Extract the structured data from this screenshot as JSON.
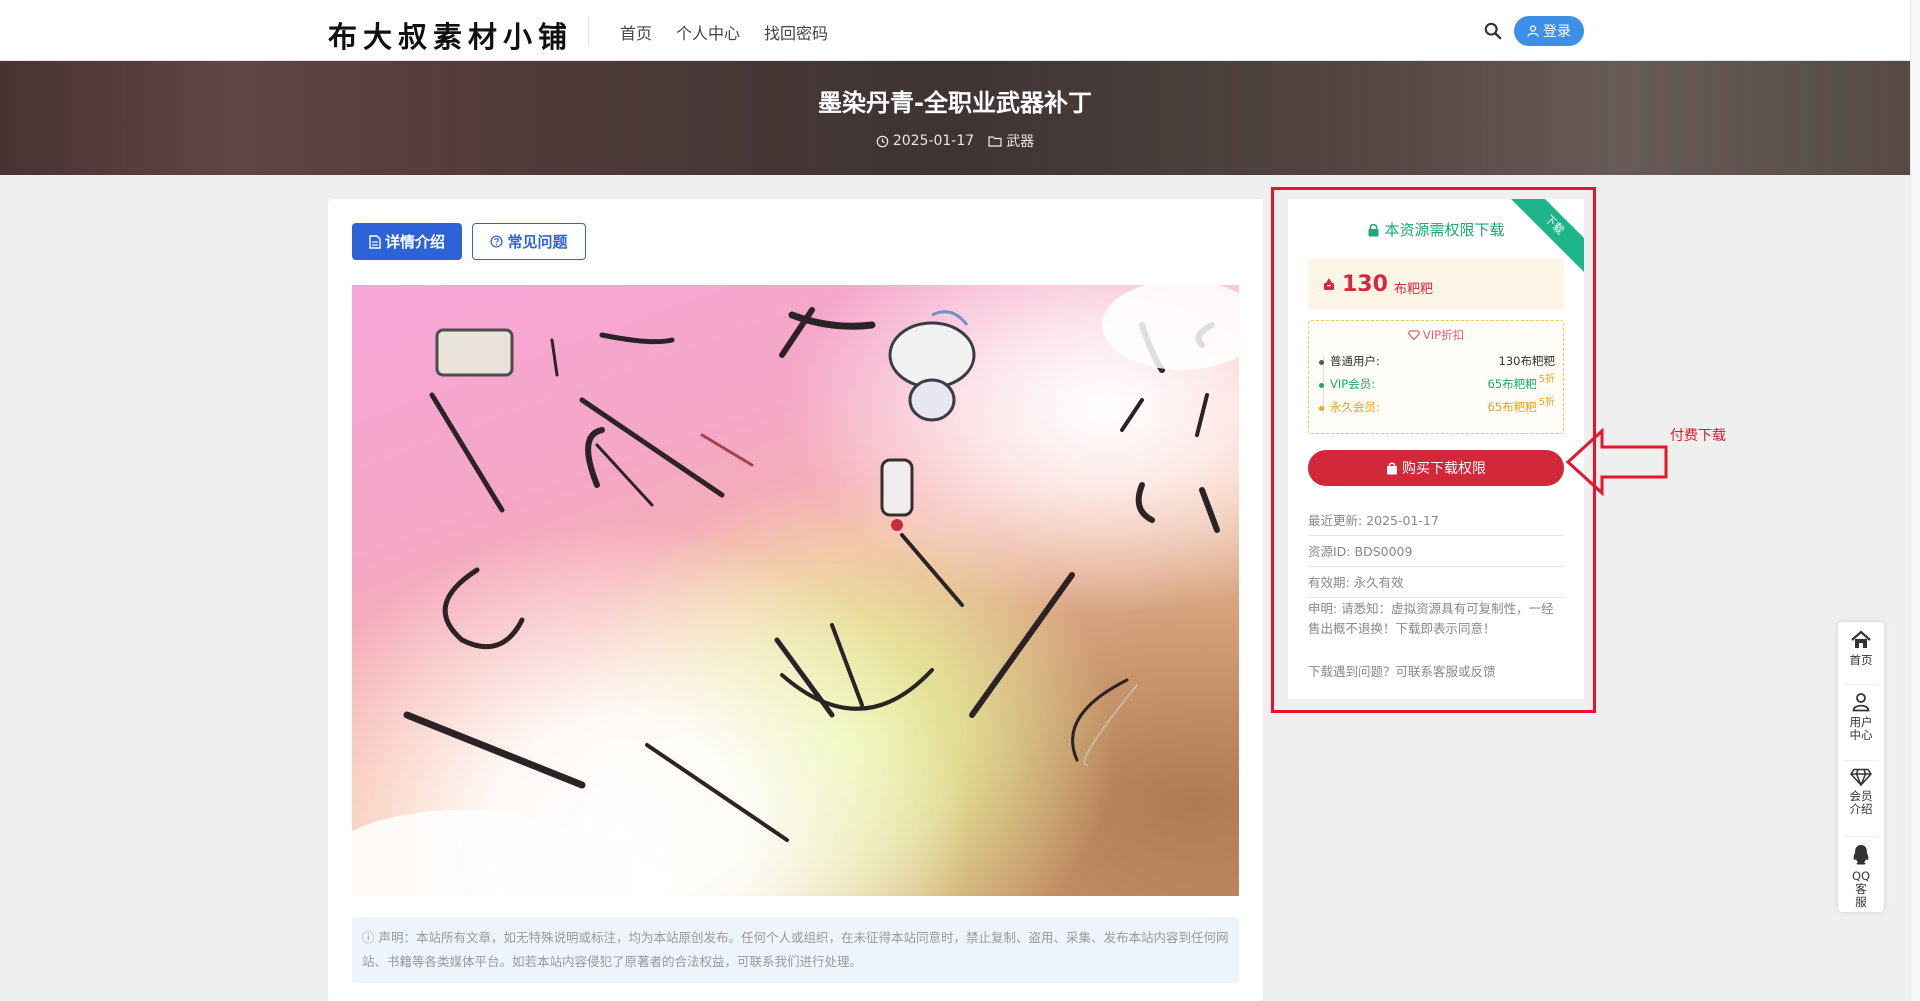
{
  "header": {
    "logo": "布大叔素材小铺",
    "nav": [
      "首页",
      "个人中心",
      "找回密码"
    ],
    "login_label": "登录"
  },
  "hero": {
    "title": "墨染丹青-全职业武器补丁",
    "date": "2025-01-17",
    "category": "武器"
  },
  "article": {
    "tabs": [
      "详情介绍",
      "常见问题"
    ],
    "notice": "声明：本站所有文章，如无特殊说明或标注，均为本站原创发布。任何个人或组织，在未征得本站同意时，禁止复制、盗用、采集、发布本站内容到任何网站、书籍等各类媒体平台。如若本站内容侵犯了原著者的合法权益，可联系我们进行处理。"
  },
  "widget": {
    "ribbon": "下载",
    "heading": "本资源需权限下载",
    "price_amount": "130",
    "price_unit": "布粑粑",
    "vip_title": "VIP折扣",
    "rows": [
      {
        "label": "普通用户:",
        "value": "130布粑粑",
        "discount": ""
      },
      {
        "label": "VIP会员:",
        "value": "65布粑粑",
        "discount": "5折"
      },
      {
        "label": "永久会员:",
        "value": "65布粑粑",
        "discount": "5折"
      }
    ],
    "buy_label": "购买下载权限",
    "updated": "最近更新: 2025-01-17",
    "resource_id": "资源ID: BDS0009",
    "validity": "有效期: 永久有效",
    "declaration": "申明: 请悉知：虚拟资源具有可复制性，一经售出概不退换！下载即表示同意！",
    "help": "下载遇到问题？可联系客服或反馈"
  },
  "annotation": {
    "label": "付费下载",
    "color": "#e5162a"
  },
  "dock": {
    "items": [
      "首页",
      "用户中心",
      "会员介绍",
      "QQ客服"
    ]
  },
  "colors": {
    "primary_blue": "#2e63d8",
    "login_blue": "#3d8fe8",
    "buy_red": "#d3283a",
    "vip_green": "#1aa874",
    "vip_gold": "#f0a020"
  }
}
